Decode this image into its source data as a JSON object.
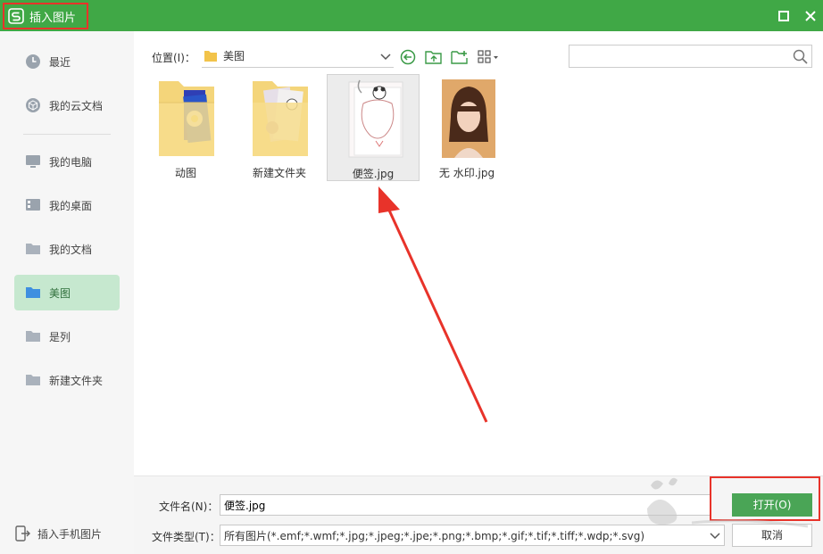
{
  "window": {
    "title": "插入图片"
  },
  "sidebar": {
    "items": [
      {
        "label": "最近",
        "icon": "clock-icon"
      },
      {
        "label": "我的云文档",
        "icon": "cloud-cube-icon"
      },
      {
        "label": "我的电脑",
        "icon": "monitor-icon"
      },
      {
        "label": "我的桌面",
        "icon": "desktop-icon"
      },
      {
        "label": "我的文档",
        "icon": "folder-icon"
      },
      {
        "label": "美图",
        "icon": "folder-icon",
        "active": true
      },
      {
        "label": "是列",
        "icon": "folder-icon"
      },
      {
        "label": "新建文件夹",
        "icon": "folder-icon"
      }
    ],
    "mobile_label": "插入手机图片"
  },
  "toolbar": {
    "location_label": "位置(I)：",
    "location_value": "美图",
    "search_placeholder": ""
  },
  "files": [
    {
      "name": "动图",
      "kind": "folder"
    },
    {
      "name": "新建文件夹",
      "kind": "folder"
    },
    {
      "name": "便签.jpg",
      "kind": "image",
      "selected": true
    },
    {
      "name": "无 水印.jpg",
      "kind": "image"
    }
  ],
  "bottom": {
    "filename_label": "文件名(N)：",
    "filename_value": "便签.jpg",
    "filetype_label": "文件类型(T)：",
    "filetype_value": "所有图片(*.emf;*.wmf;*.jpg;*.jpeg;*.jpe;*.png;*.bmp;*.gif;*.tif;*.tiff;*.wdp;*.svg)",
    "open_label": "打开(O)",
    "cancel_label": "取消"
  },
  "colors": {
    "title_bar": "#40a846",
    "accent": "#4aa556",
    "highlight": "#e8332a",
    "active_item": "#c6e8cf"
  }
}
